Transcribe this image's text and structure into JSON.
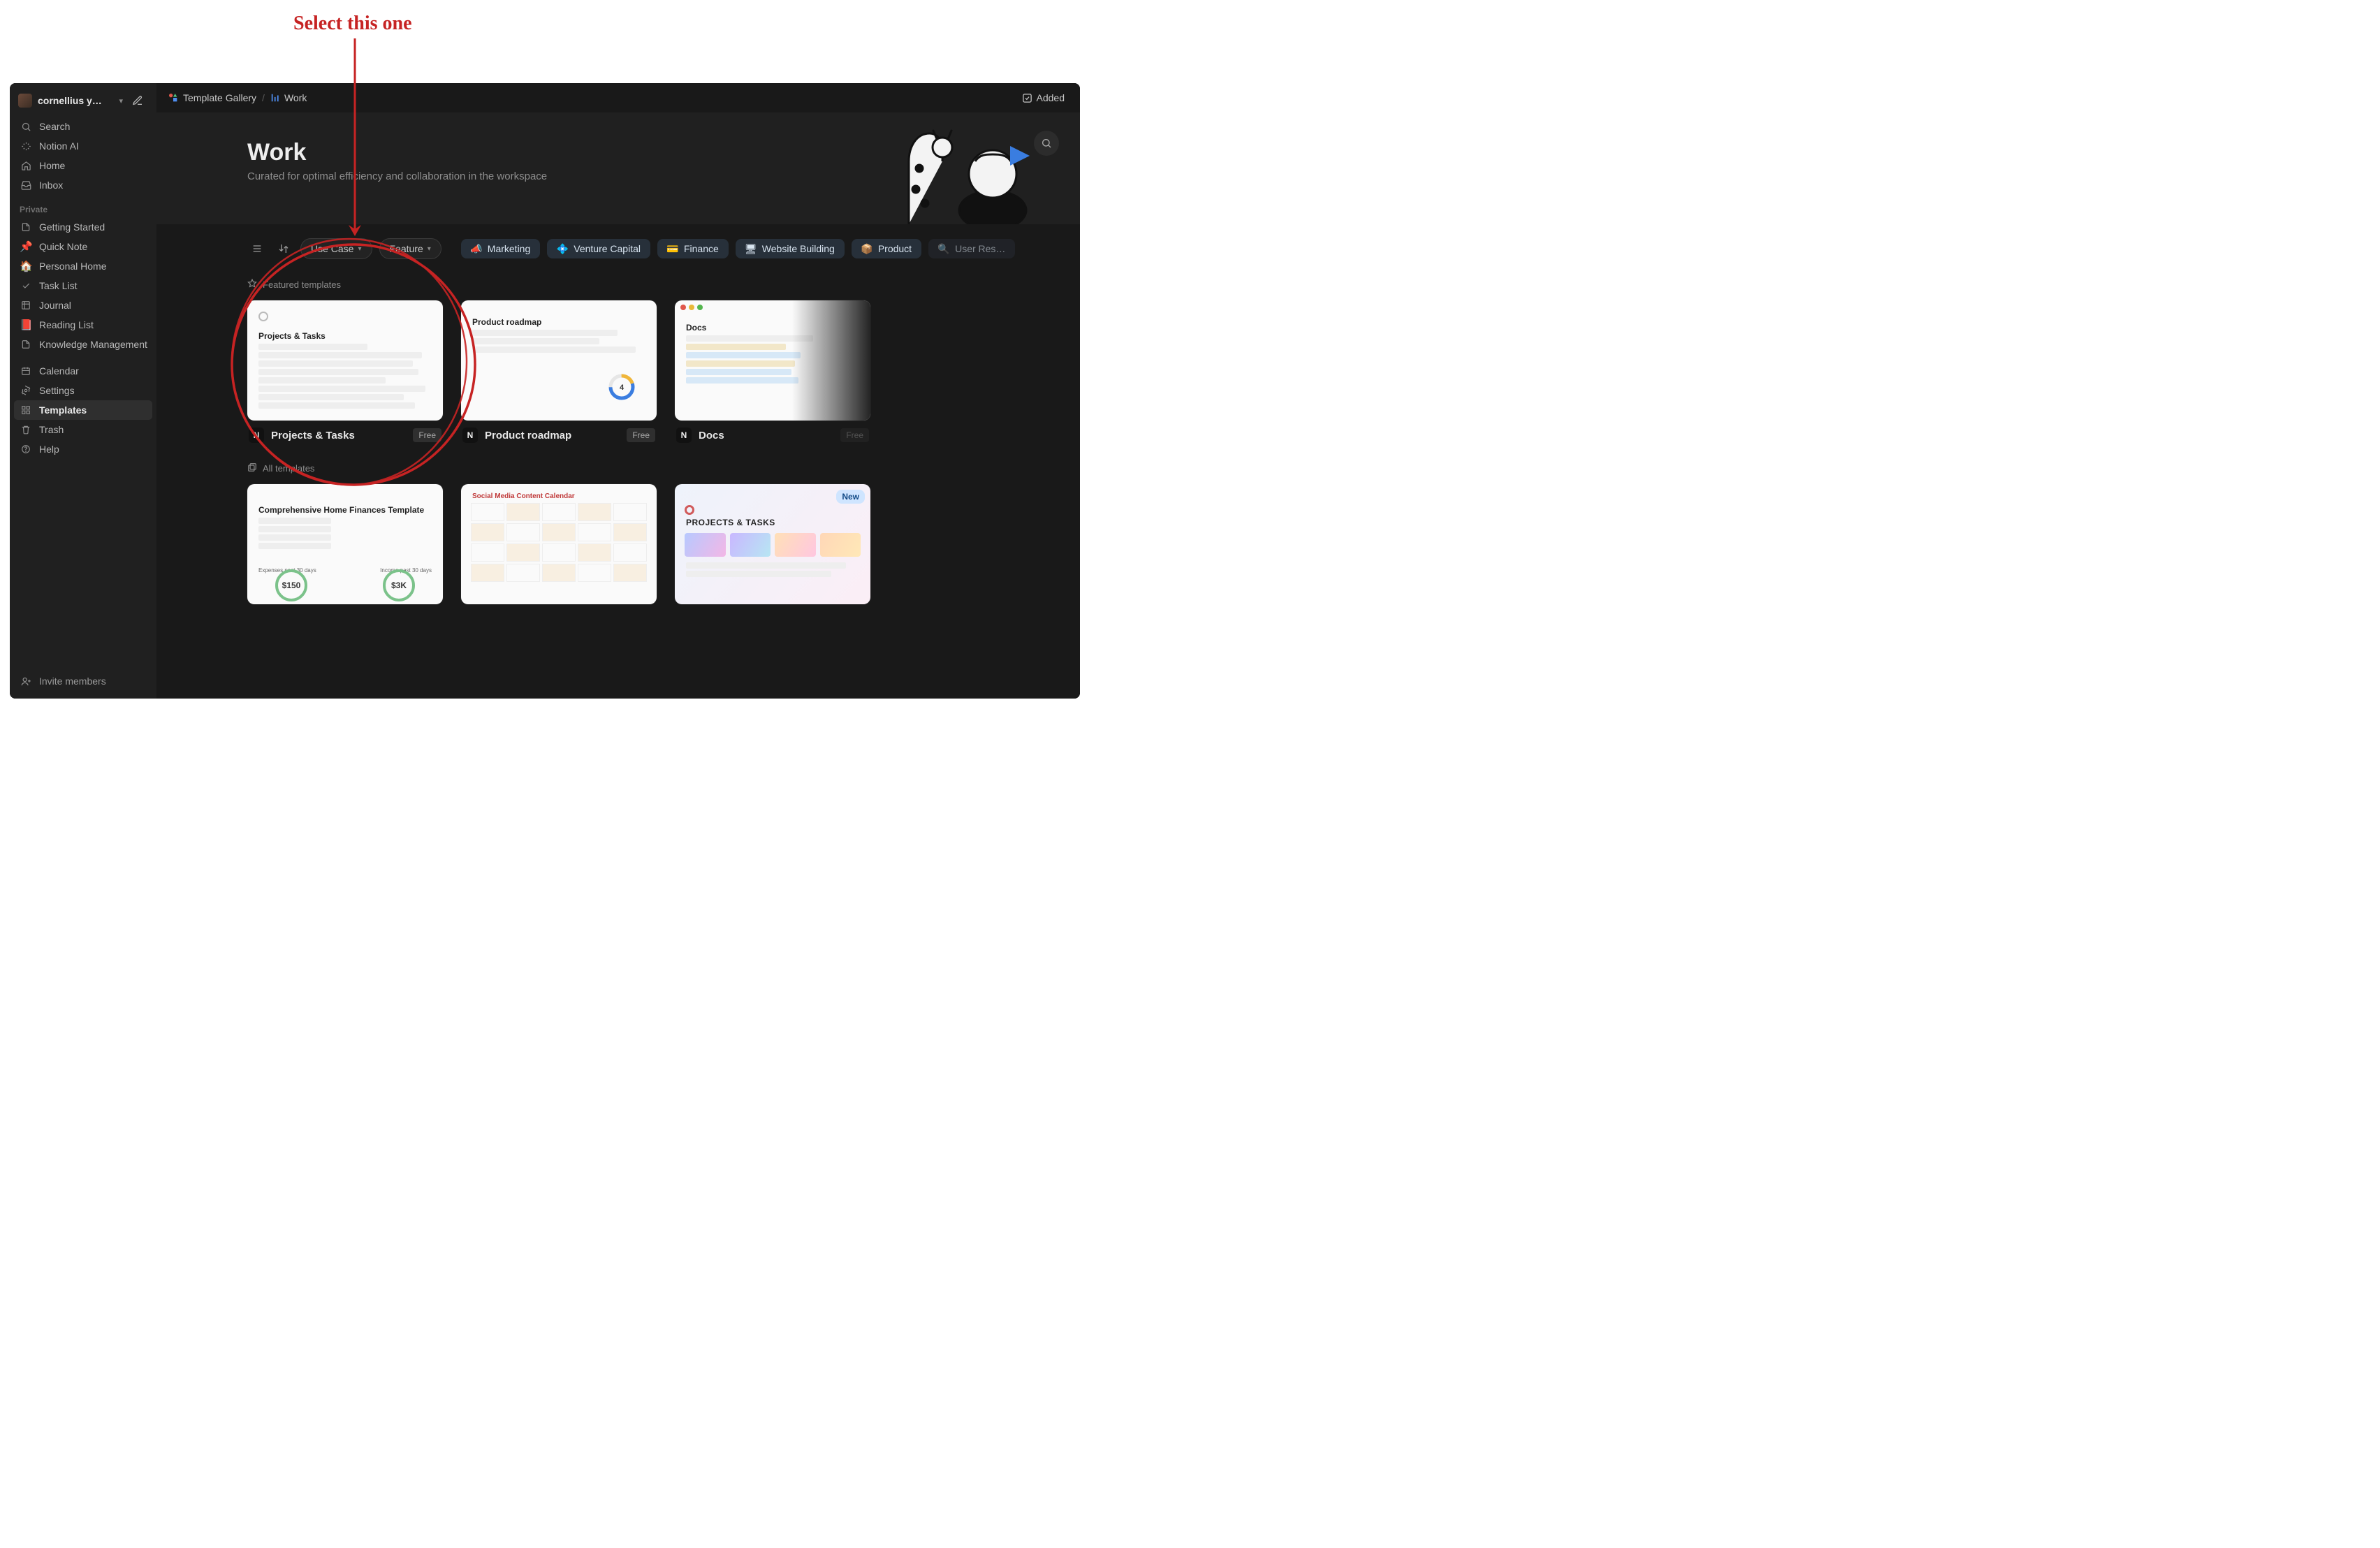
{
  "annotation": {
    "text": "Select this one"
  },
  "workspace": {
    "name": "cornellius y…"
  },
  "sidebar": {
    "nav": [
      {
        "icon": "search",
        "label": "Search"
      },
      {
        "icon": "sparkle",
        "label": "Notion AI"
      },
      {
        "icon": "home",
        "label": "Home"
      },
      {
        "icon": "inbox",
        "label": "Inbox"
      }
    ],
    "private_label": "Private",
    "private": [
      {
        "emoji": "doc",
        "label": "Getting Started"
      },
      {
        "emoji": "📌",
        "label": "Quick Note"
      },
      {
        "emoji": "🏠",
        "label": "Personal Home"
      },
      {
        "emoji": "check",
        "label": "Task List"
      },
      {
        "emoji": "grid",
        "label": "Journal"
      },
      {
        "emoji": "📕",
        "label": "Reading List"
      },
      {
        "emoji": "doc",
        "label": "Knowledge Management"
      }
    ],
    "system": [
      {
        "icon": "calendar",
        "label": "Calendar"
      },
      {
        "icon": "gear",
        "label": "Settings"
      },
      {
        "icon": "template",
        "label": "Templates",
        "active": true
      },
      {
        "icon": "trash",
        "label": "Trash"
      },
      {
        "icon": "help",
        "label": "Help"
      }
    ],
    "invite": "Invite members"
  },
  "breadcrumb": {
    "root": "Template Gallery",
    "current": "Work"
  },
  "topbar": {
    "added": "Added"
  },
  "hero": {
    "title": "Work",
    "subtitle": "Curated for optimal efficiency and collaboration in the workspace"
  },
  "filter": {
    "use_case": "Use Case",
    "feature": "Feature",
    "chips": [
      {
        "icon": "📣",
        "label": "Marketing",
        "color": "#5aa1e3"
      },
      {
        "icon": "💠",
        "label": "Venture Capital",
        "color": "#5aa1e3"
      },
      {
        "icon": "💳",
        "label": "Finance",
        "color": "#5aa1e3"
      },
      {
        "icon": "🖥",
        "label": "Website Building",
        "color": "#5aa1e3"
      },
      {
        "icon": "📦",
        "label": "Product",
        "color": "#5aa1e3"
      },
      {
        "icon": "🔍",
        "label": "User Res…",
        "color": "#5aa1e3"
      }
    ]
  },
  "sections": {
    "featured": "Featured templates",
    "all": "All templates"
  },
  "featured": [
    {
      "title": "Projects & Tasks",
      "badge": "Free",
      "thumb_title": "Projects & Tasks"
    },
    {
      "title": "Product roadmap",
      "badge": "Free",
      "thumb_title": "Product roadmap"
    },
    {
      "title": "Docs",
      "badge": "Free",
      "thumb_title": "Docs",
      "dimmed": true
    }
  ],
  "all": [
    {
      "thumb_title": "Comprehensive Home Finances Template",
      "kpi1": "$150",
      "kpi2": "$3K",
      "l1": "Expenses past 30 days",
      "l2": "Income past 30 days"
    },
    {
      "thumb_title": "Social Media Content Calendar"
    },
    {
      "thumb_title": "PROJECTS & TASKS",
      "new": "New"
    }
  ]
}
